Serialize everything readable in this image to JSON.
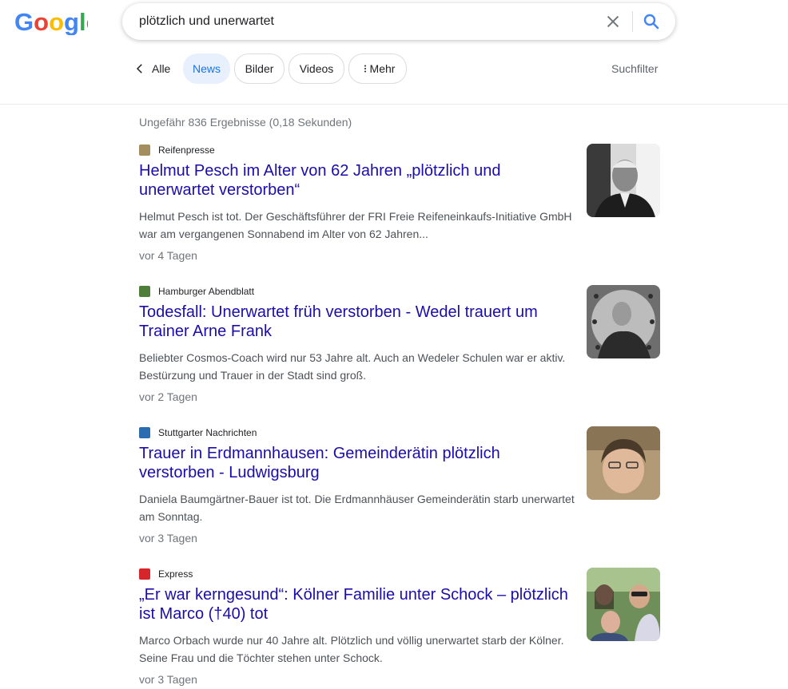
{
  "search": {
    "query": "plötzlich und unerwartet"
  },
  "tabs": {
    "back_label": "Alle",
    "items": [
      {
        "label": "News",
        "active": true
      },
      {
        "label": "Bilder",
        "active": false
      },
      {
        "label": "Videos",
        "active": false
      },
      {
        "label": "Mehr",
        "active": false,
        "icon": "more-vert-icon"
      }
    ],
    "filter_label": "Suchfilter"
  },
  "stats": "Ungefähr 836 Ergebnisse (0,18 Sekunden)",
  "results": [
    {
      "source": "Reifenpresse",
      "title": "Helmut Pesch im Alter von 62 Jahren „plötzlich und unerwartet verstorben“",
      "snippet": "Helmut Pesch ist tot. Der Geschäftsführer der FRI Freie Reifeneinkaufs-Initiative GmbH war am vergangenen Sonnabend im Alter von 62 Jahren...",
      "date": "vor 4 Tagen"
    },
    {
      "source": "Hamburger Abendblatt",
      "title": "Todesfall: Unerwartet früh verstorben - Wedel trauert um Trainer Arne Frank",
      "snippet": "Beliebter Cosmos-Coach wird nur 53 Jahre alt. Auch an Wedeler Schulen war er aktiv. Bestürzung und Trauer in der Stadt sind groß.",
      "date": "vor 2 Tagen"
    },
    {
      "source": "Stuttgarter Nachrichten",
      "title": "Trauer in Erdmannhausen: Gemeinderätin plötzlich verstorben - Ludwigsburg",
      "snippet": "Daniela Baumgärtner-Bauer ist tot. Die Erdmannhäuser Gemeinderätin starb unerwartet am Sonntag.",
      "date": "vor 3 Tagen"
    },
    {
      "source": "Express",
      "title": "„Er war kerngesund“: Kölner Familie unter Schock – plötzlich ist Marco (†40) tot",
      "snippet": "Marco Orbach wurde nur 40 Jahre alt. Plötzlich und völlig unerwartet starb der Kölner. Seine Frau und die Töchter stehen unter Schock.",
      "date": "vor 3 Tagen"
    }
  ],
  "colors": {
    "link": "#1a0dab",
    "active_chip_bg": "#e8f0fe",
    "active_chip_text": "#1a73e8"
  }
}
